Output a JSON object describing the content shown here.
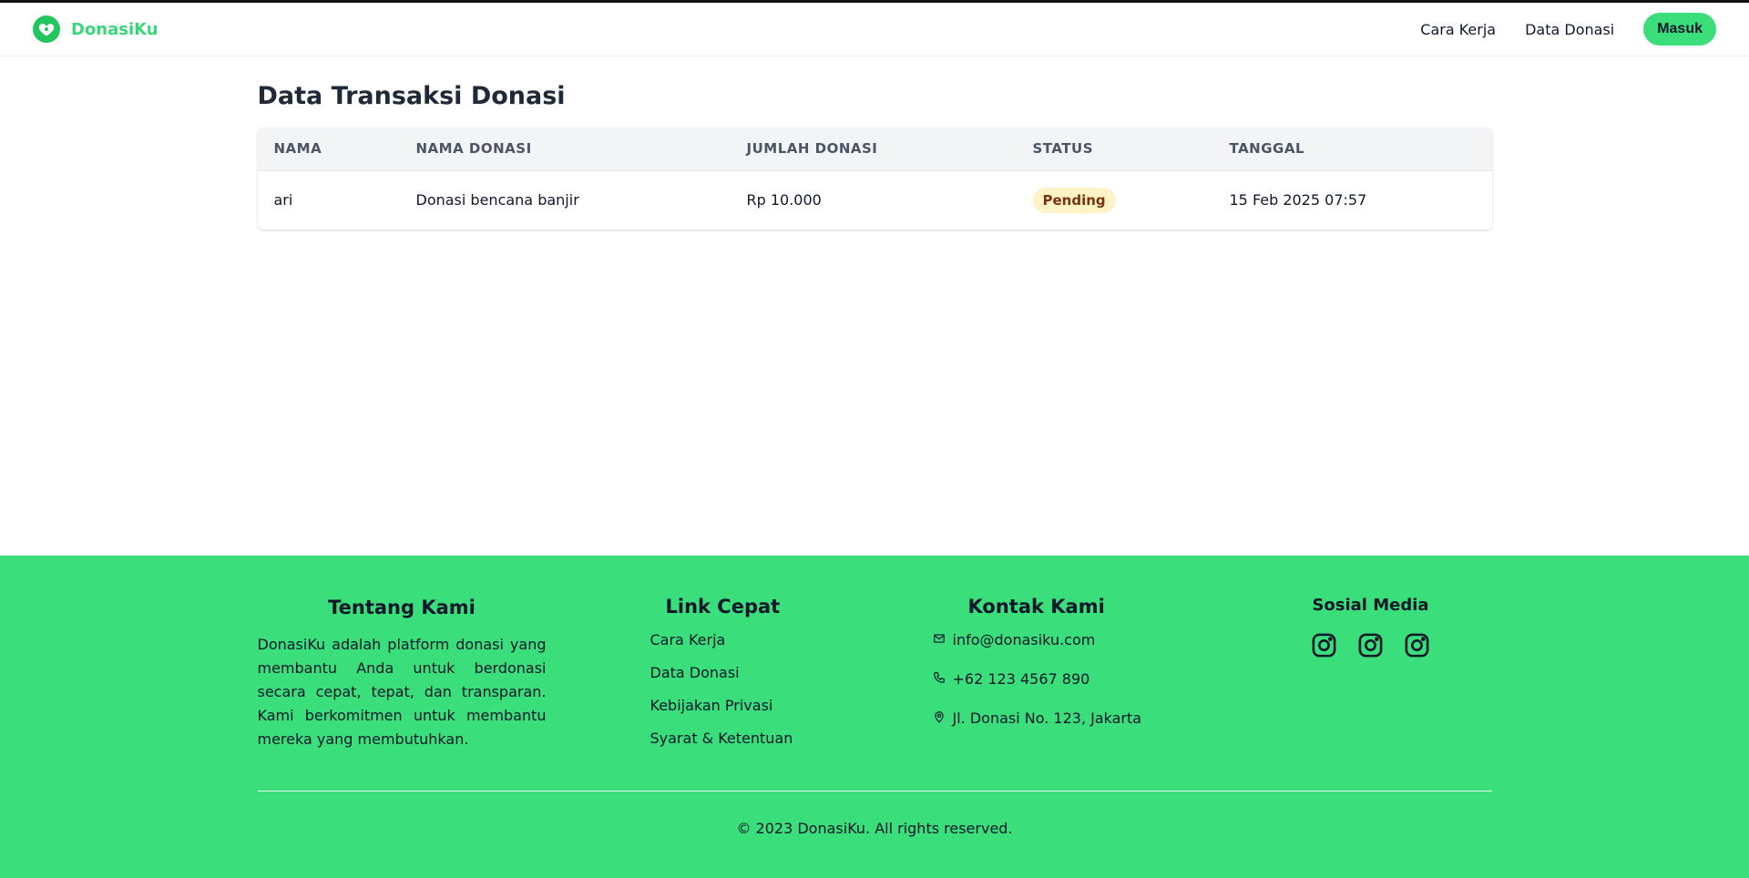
{
  "navbar": {
    "brand": "DonasiKu",
    "links": [
      "Cara Kerja",
      "Data Donasi"
    ],
    "login_label": "Masuk",
    "colors": {
      "accent": "#3ADE7A",
      "brand_text": "#3AD67A"
    }
  },
  "main": {
    "title": "Data Transaksi Donasi",
    "table": {
      "headers": [
        "NAMA",
        "NAMA DONASI",
        "JUMLAH DONASI",
        "STATUS",
        "TANGGAL"
      ],
      "rows": [
        {
          "nama": "ari",
          "nama_donasi": "Donasi bencana banjir",
          "jumlah": "Rp 10.000",
          "status": "Pending",
          "tanggal": "15 Feb 2025 07:57"
        }
      ]
    }
  },
  "footer": {
    "about": {
      "title": "Tentang Kami",
      "text": "DonasiKu adalah platform donasi yang membantu Anda untuk berdonasi secara cepat, tepat, dan transparan. Kami berkomitmen untuk membantu mereka yang membutuhkan."
    },
    "links": {
      "title": "Link Cepat",
      "items": [
        "Cara Kerja",
        "Data Donasi",
        "Kebijakan Privasi",
        "Syarat & Ketentuan"
      ]
    },
    "contact": {
      "title": "Kontak Kami",
      "email": "info@donasiku.com",
      "phone": "+62 123 4567 890",
      "address": "Jl. Donasi No. 123, Jakarta"
    },
    "social": {
      "title": "Sosial Media",
      "icons": [
        "instagram-icon",
        "instagram-icon",
        "instagram-icon"
      ]
    },
    "copyright": "© 2023 DonasiKu. All rights reserved."
  }
}
